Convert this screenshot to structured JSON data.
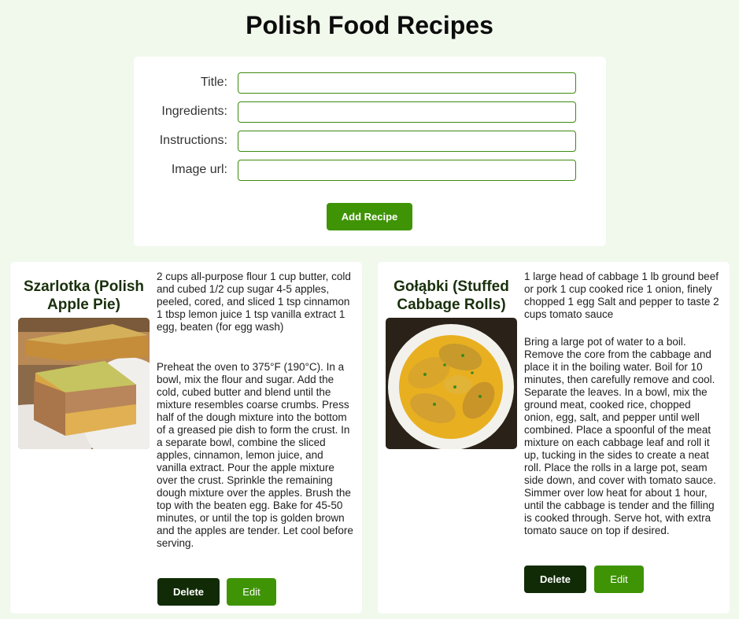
{
  "page": {
    "title": "Polish Food Recipes"
  },
  "form": {
    "fields": [
      {
        "label": "Title:",
        "value": ""
      },
      {
        "label": "Ingredients:",
        "value": ""
      },
      {
        "label": "Instructions:",
        "value": ""
      },
      {
        "label": "Image url:",
        "value": ""
      }
    ],
    "submit_label": "Add Recipe"
  },
  "recipes": [
    {
      "title": "Szarlotka (Polish Apple Pie)",
      "ingredients": "2 cups all-purpose flour 1 cup butter, cold and cubed 1/2 cup sugar 4-5 apples, peeled, cored, and sliced 1 tsp cinnamon 1 tbsp lemon juice 1 tsp vanilla extract 1 egg, beaten (for egg wash)",
      "instructions": "Preheat the oven to 375°F (190°C). In a bowl, mix the flour and sugar. Add the cold, cubed butter and blend until the mixture resembles coarse crumbs. Press half of the dough mixture into the bottom of a greased pie dish to form the crust. In a separate bowl, combine the sliced apples, cinnamon, lemon juice, and vanilla extract. Pour the apple mixture over the crust. Sprinkle the remaining dough mixture over the apples. Brush the top with the beaten egg. Bake for 45-50 minutes, or until the top is golden brown and the apples are tender. Let cool before serving.",
      "delete_label": "Delete",
      "edit_label": "Edit"
    },
    {
      "title": "Gołąbki (Stuffed Cabbage Rolls)",
      "ingredients": "1 large head of cabbage 1 lb ground beef or pork 1 cup cooked rice 1 onion, finely chopped 1 egg Salt and pepper to taste 2 cups tomato sauce",
      "instructions": "Bring a large pot of water to a boil. Remove the core from the cabbage and place it in the boiling water. Boil for 10 minutes, then carefully remove and cool. Separate the leaves. In a bowl, mix the ground meat, cooked rice, chopped onion, egg, salt, and pepper until well combined. Place a spoonful of the meat mixture on each cabbage leaf and roll it up, tucking in the sides to create a neat roll. Place the rolls in a large pot, seam side down, and cover with tomato sauce. Simmer over low heat for about 1 hour, until the cabbage is tender and the filling is cooked through. Serve hot, with extra tomato sauce on top if desired.",
      "delete_label": "Delete",
      "edit_label": "Edit"
    }
  ]
}
